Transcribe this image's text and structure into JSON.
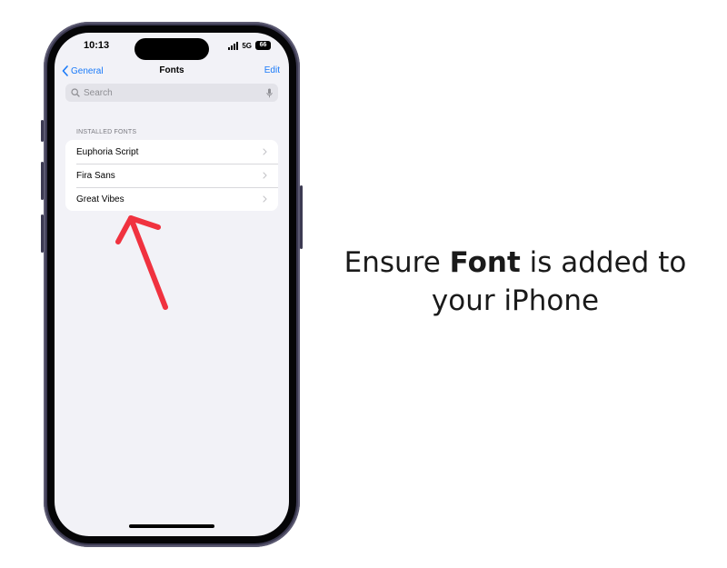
{
  "status_bar": {
    "time": "10:13",
    "network": "5G",
    "battery": "66"
  },
  "nav": {
    "back_label": "General",
    "title": "Fonts",
    "edit_label": "Edit"
  },
  "search": {
    "placeholder": "Search"
  },
  "installed_fonts": {
    "header": "INSTALLED FONTS",
    "items": [
      {
        "label": "Euphoria Script"
      },
      {
        "label": "Fira Sans"
      },
      {
        "label": "Great Vibes"
      }
    ]
  },
  "caption": {
    "prefix": "Ensure ",
    "bold": "Font",
    "suffix": " is added to your iPhone"
  },
  "colors": {
    "accent": "#1a7af8",
    "annotation_arrow": "#f0323f",
    "phone_frame": "#3c3a52"
  },
  "icons": {
    "back": "chevron-left-icon",
    "search": "magnifier-icon",
    "mic": "microphone-icon",
    "row": "chevron-right-icon"
  }
}
